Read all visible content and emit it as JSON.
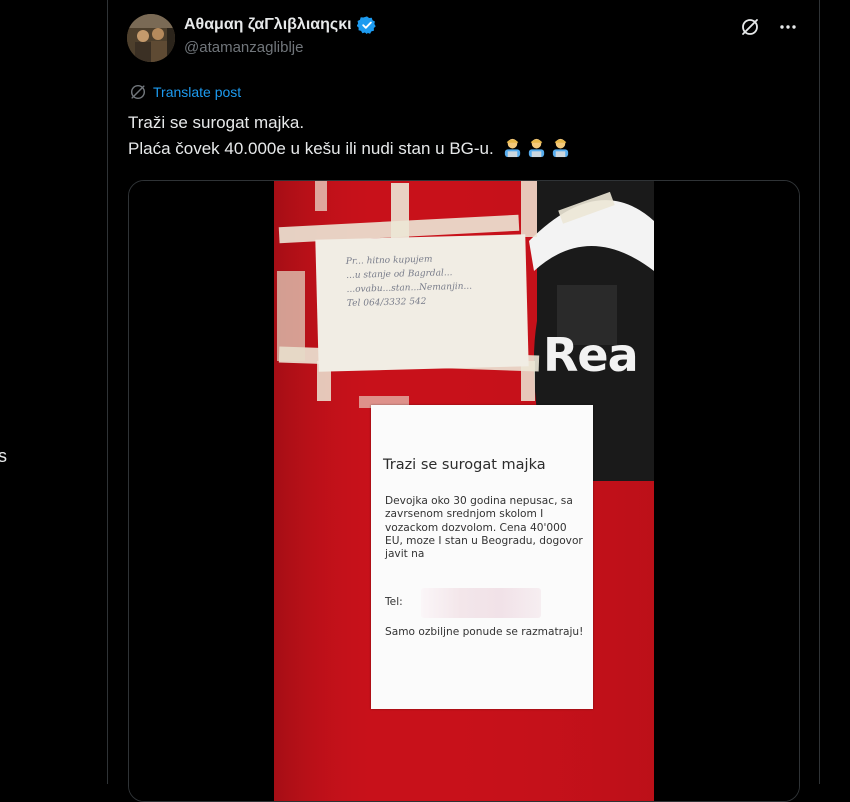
{
  "left_fragment": "s",
  "post": {
    "author_name": "Αθαμαη ζαΓλιβλιαηςκι",
    "author_handle": "@atamanzagliblje",
    "translate_label": "Translate post",
    "text_line1": "Traži se surogat majka.",
    "text_line2": "Plaća čovek 40.000e u kešu ili nudi stan u BG-u.",
    "emoji_name": "man-technologist-emoji",
    "verified_color": "#1d9bf0"
  },
  "image": {
    "overlay_word": "Rea",
    "handwritten_note": [
      "Pr... hitno kupujem",
      "...u stanje od Bagrdal...",
      "...ovabu...stan...Nemanjin...",
      "Tel 064/3332 542"
    ],
    "sign": {
      "title": "Trazi se surogat majka",
      "body": "Devojka oko 30 godina nepusac, sa zavrsenom srednjom skolom I vozackom dozvolom. Cena 40'000 EU, moze I stan u Beogradu, dogovor javit na",
      "tel_label": "Tel:",
      "footer": "Samo ozbiljne ponude se razmatraju!"
    }
  }
}
